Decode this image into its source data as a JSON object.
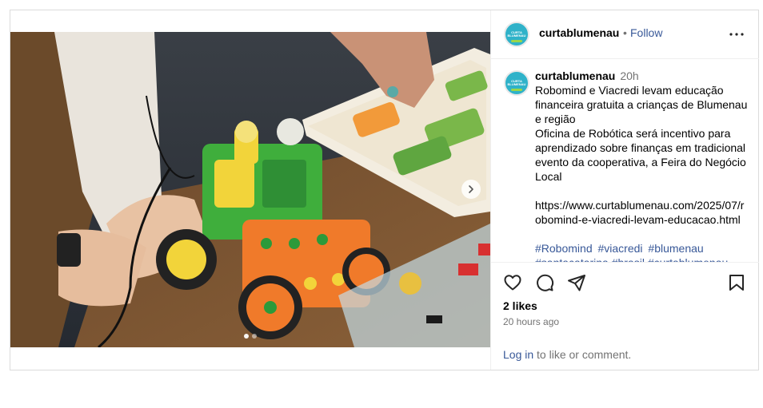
{
  "account": {
    "username": "curtablumenau",
    "separator": "•",
    "follow_label": "Follow",
    "avatar_text": "CURTA BLUMENAU",
    "avatar_color": "#2fb2c9"
  },
  "caption": {
    "time": "20h",
    "lines": [
      "Robomind e Viacredi levam educação",
      "financeira gratuita a crianças de Blumenau",
      "e região",
      "Oficina de Robótica será incentivo para",
      "aprendizado sobre finanças em tradicional",
      "evento da cooperativa, a Feira do Negócio",
      "Local",
      "",
      "https://www.curtablumenau.com/2025/07/r",
      "obomind-e-viacredi-levam-educacao.html",
      ""
    ],
    "hashtags": [
      "#Robomind",
      "#viacredi",
      "#blumenau"
    ],
    "hashtags_cut": "#santacatarina #brasil #curtablumenau"
  },
  "media": {
    "carousel_count": 2,
    "carousel_active": 0
  },
  "engagement": {
    "likes": "2 likes",
    "time_ago": "20 hours ago",
    "login_link": "Log in",
    "login_suffix": " to like or comment."
  },
  "colors": {
    "link": "#385898",
    "muted": "#737373",
    "border": "#dbdbdb"
  }
}
